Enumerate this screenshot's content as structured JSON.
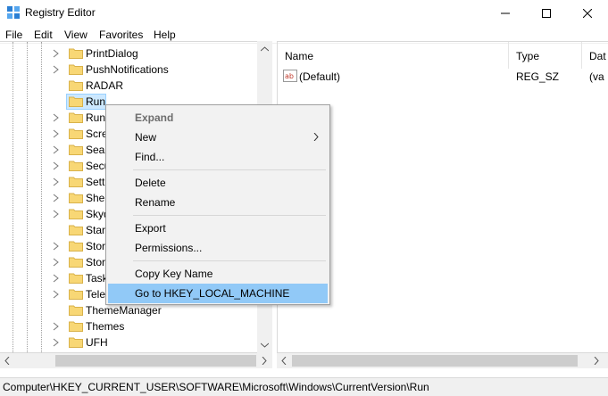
{
  "window": {
    "title": "Registry Editor"
  },
  "menu": [
    "File",
    "Edit",
    "View",
    "Favorites",
    "Help"
  ],
  "tree": {
    "items": [
      {
        "label": "PrintDialog",
        "expandable": true
      },
      {
        "label": "PushNotifications",
        "expandable": true
      },
      {
        "label": "RADAR",
        "expandable": false
      },
      {
        "label": "Run",
        "expandable": false,
        "selected": true
      },
      {
        "label": "Run",
        "expandable": true
      },
      {
        "label": "Scre",
        "expandable": true
      },
      {
        "label": "Sear",
        "expandable": true
      },
      {
        "label": "Secu",
        "expandable": true
      },
      {
        "label": "Setti",
        "expandable": true
      },
      {
        "label": "Shel",
        "expandable": true
      },
      {
        "label": "Skyd",
        "expandable": true
      },
      {
        "label": "Start",
        "expandable": false
      },
      {
        "label": "Stor",
        "expandable": true
      },
      {
        "label": "Stor",
        "expandable": true
      },
      {
        "label": "Task",
        "expandable": true
      },
      {
        "label": "Tele",
        "expandable": true
      },
      {
        "label": "ThemeManager",
        "expandable": false
      },
      {
        "label": "Themes",
        "expandable": true
      },
      {
        "label": "UFH",
        "expandable": true
      }
    ]
  },
  "values": {
    "columns": [
      "Name",
      "Type",
      "Dat"
    ],
    "rows": [
      {
        "name": "(Default)",
        "type": "REG_SZ",
        "data": "(va"
      }
    ]
  },
  "context_menu": {
    "items": [
      {
        "label": "Expand",
        "disabled": true
      },
      {
        "label": "New",
        "submenu": true
      },
      {
        "label": "Find..."
      },
      {
        "separator": true
      },
      {
        "label": "Delete"
      },
      {
        "label": "Rename"
      },
      {
        "separator": true
      },
      {
        "label": "Export"
      },
      {
        "label": "Permissions..."
      },
      {
        "separator": true
      },
      {
        "label": "Copy Key Name"
      },
      {
        "label": "Go to HKEY_LOCAL_MACHINE",
        "highlighted": true
      }
    ]
  },
  "status": {
    "path": "Computer\\HKEY_CURRENT_USER\\SOFTWARE\\Microsoft\\Windows\\CurrentVersion\\Run"
  },
  "colors": {
    "selection": "#cce8ff",
    "menu_highlight": "#91c9f7",
    "folder": "#f8d775"
  }
}
